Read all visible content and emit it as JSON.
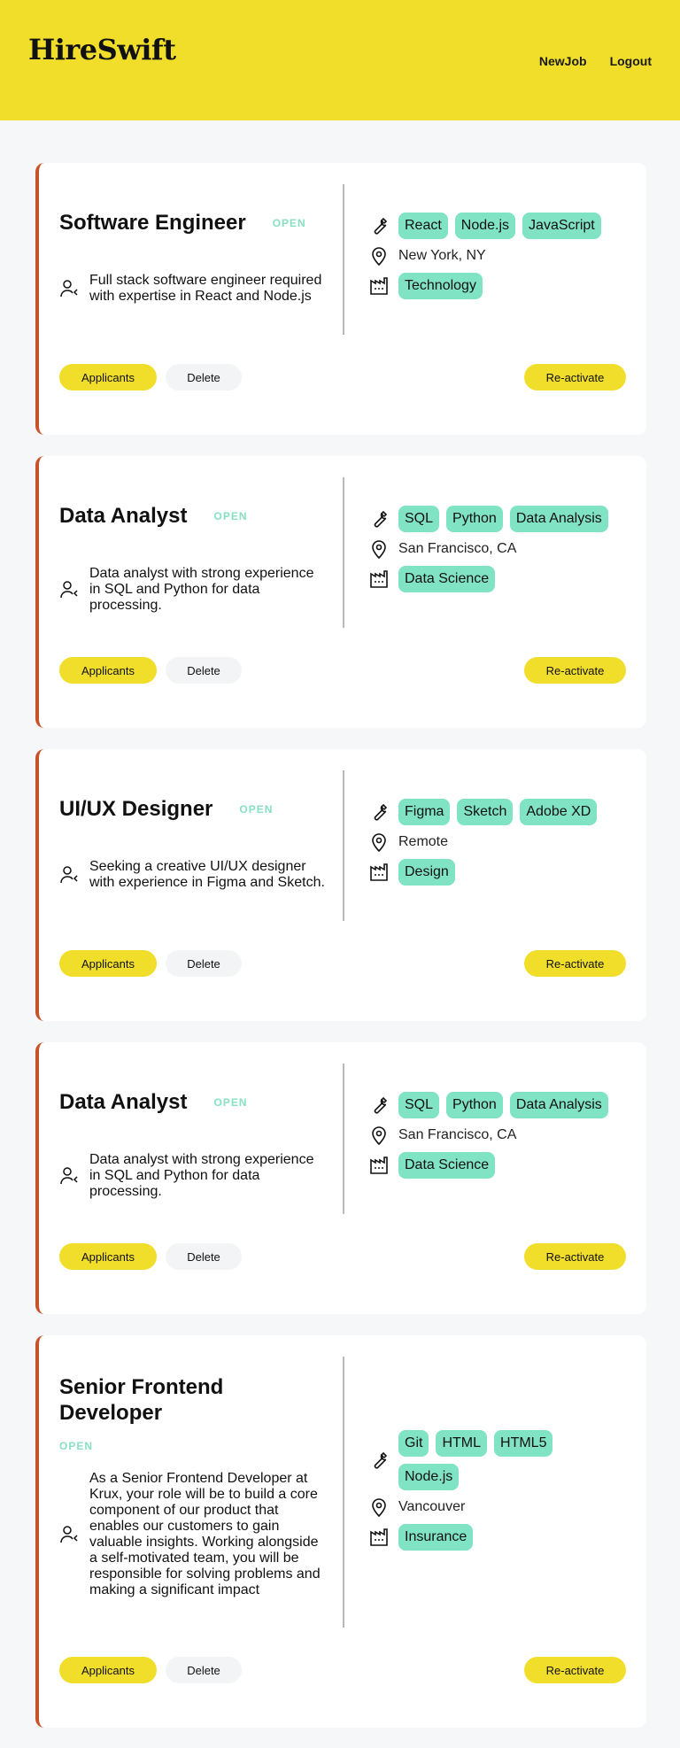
{
  "header": {
    "logo": "HireSwift",
    "nav": [
      "NewJob",
      "Logout"
    ]
  },
  "jobs": [
    {
      "title": "Software Engineer",
      "status": "OPEN",
      "description": "Full stack software engineer required with expertise in React and Node.js",
      "skills": [
        "React",
        "Node.js",
        "JavaScript"
      ],
      "location": "New York, NY",
      "industry": "Technology",
      "buttons": {
        "applicants": "Applicants",
        "delete": "Delete",
        "reactivate": "Re-activate"
      }
    },
    {
      "title": "Data Analyst",
      "status": "OPEN",
      "description": "Data analyst with strong experience in SQL and Python for data processing.",
      "skills": [
        "SQL",
        "Python",
        "Data Analysis"
      ],
      "location": "San Francisco, CA",
      "industry": "Data Science",
      "buttons": {
        "applicants": "Applicants",
        "delete": "Delete",
        "reactivate": "Re-activate"
      }
    },
    {
      "title": "UI/UX Designer",
      "status": "OPEN",
      "description": "Seeking a creative UI/UX designer with experience in Figma and Sketch.",
      "skills": [
        "Figma",
        "Sketch",
        "Adobe XD"
      ],
      "location": "Remote",
      "industry": "Design",
      "buttons": {
        "applicants": "Applicants",
        "delete": "Delete",
        "reactivate": "Re-activate"
      }
    },
    {
      "title": "Data Analyst",
      "status": "OPEN",
      "description": "Data analyst with strong experience in SQL and Python for data processing.",
      "skills": [
        "SQL",
        "Python",
        "Data Analysis"
      ],
      "location": "San Francisco, CA",
      "industry": "Data Science",
      "buttons": {
        "applicants": "Applicants",
        "delete": "Delete",
        "reactivate": "Re-activate"
      }
    },
    {
      "title": "Senior Frontend Developer",
      "status": "OPEN",
      "description": "As a Senior Frontend Developer at Krux, your role will be to build a core component of our product that enables our customers to gain valuable insights. Working alongside a self-motivated team, you will be responsible for solving problems and making a significant impact",
      "skills": [
        "Git",
        "HTML",
        "HTML5",
        "Node.js"
      ],
      "location": "Vancouver",
      "industry": "Insurance",
      "buttons": {
        "applicants": "Applicants",
        "delete": "Delete",
        "reactivate": "Re-activate"
      }
    }
  ]
}
